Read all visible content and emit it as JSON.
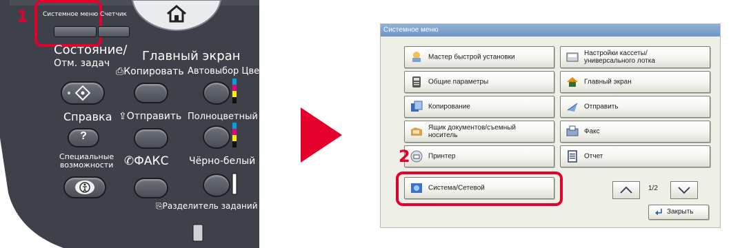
{
  "panel": {
    "system_menu_key": "Системное меню",
    "counter_key": "Счетчик",
    "status_label_line1": "Состояние/",
    "status_label_line2": "Отм. задач",
    "home_label": "Главный экран",
    "copy_label": "Копировать",
    "auto_color_label": "Автовыбор Цвета",
    "help_label": "Справка",
    "help_glyph": "?",
    "send_label": "Отправить",
    "fullcolor_label": "Полноцветный",
    "accessibility_line1": "Специальные",
    "accessibility_line2": "возможности",
    "fax_label": "ФАКС",
    "bw_label": "Чёрно-белый",
    "job_separator_label": "Разделитель заданий",
    "callout_1": "1",
    "accent_color": "#e4002b"
  },
  "screen": {
    "title": "Системное меню",
    "buttons": [
      {
        "label": "Мастер быстрой установки",
        "icon": "wizard-icon"
      },
      {
        "label": "Настройки кассеты/ универсального лотка",
        "icon": "cassette-icon"
      },
      {
        "label": "Общие параметры",
        "icon": "common-settings-icon"
      },
      {
        "label": "Главный экран",
        "icon": "home-icon"
      },
      {
        "label": "Копирование",
        "icon": "copy-icon"
      },
      {
        "label": "Отправить",
        "icon": "send-icon"
      },
      {
        "label": "Ящик документов/съемный носитель",
        "icon": "document-box-icon"
      },
      {
        "label": "Факс",
        "icon": "fax-icon"
      },
      {
        "label": "Принтер",
        "icon": "printer-icon"
      },
      {
        "label": "Отчет",
        "icon": "report-icon"
      },
      {
        "label": "Система/Сетевой",
        "icon": "system-network-icon"
      }
    ],
    "page_indicator": "1/2",
    "close_label": "Закрыть",
    "callout_2": "2"
  }
}
